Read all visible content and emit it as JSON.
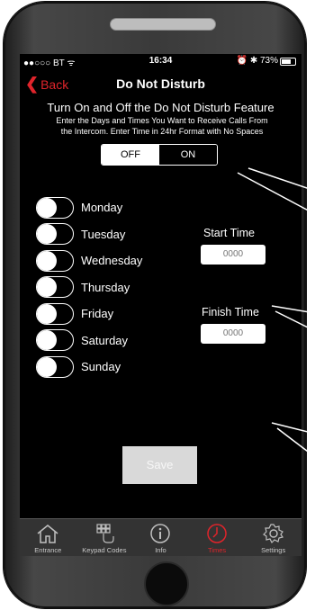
{
  "status": {
    "carrier": "●●○○○ BT ᯤ",
    "time": "16:34",
    "right": "⏰ ✱ 73%"
  },
  "nav": {
    "back_label": "Back",
    "title": "Do Not Disturb"
  },
  "intro": {
    "heading": "Turn On and Off the Do Not Disturb Feature",
    "line1": "Enter the Days and Times You Want to Receive Calls From",
    "line2": "the Intercom.    Enter Time in 24hr Format with No Spaces"
  },
  "toggle_segment": {
    "off_label": "OFF",
    "on_label": "ON",
    "selected": "OFF"
  },
  "days": [
    {
      "label": "Monday",
      "on": false
    },
    {
      "label": "Tuesday",
      "on": false
    },
    {
      "label": "Wednesday",
      "on": false
    },
    {
      "label": "Thursday",
      "on": false
    },
    {
      "label": "Friday",
      "on": false
    },
    {
      "label": "Saturday",
      "on": false
    },
    {
      "label": "Sunday",
      "on": false
    }
  ],
  "start_time": {
    "label": "Start Time",
    "placeholder": "0000"
  },
  "finish_time": {
    "label": "Finish Time",
    "placeholder": "0000"
  },
  "save_label": "Save",
  "tabs": [
    {
      "label": "Entrance",
      "icon": "house-icon"
    },
    {
      "label": "Keypad Codes",
      "icon": "keypad-icon"
    },
    {
      "label": "Info",
      "icon": "info-icon"
    },
    {
      "label": "Times",
      "icon": "clock-icon",
      "active": true
    },
    {
      "label": "Settings",
      "icon": "gear-icon"
    }
  ],
  "colors": {
    "accent": "#e0242b",
    "background": "#000000",
    "tabbar": "#333333"
  }
}
